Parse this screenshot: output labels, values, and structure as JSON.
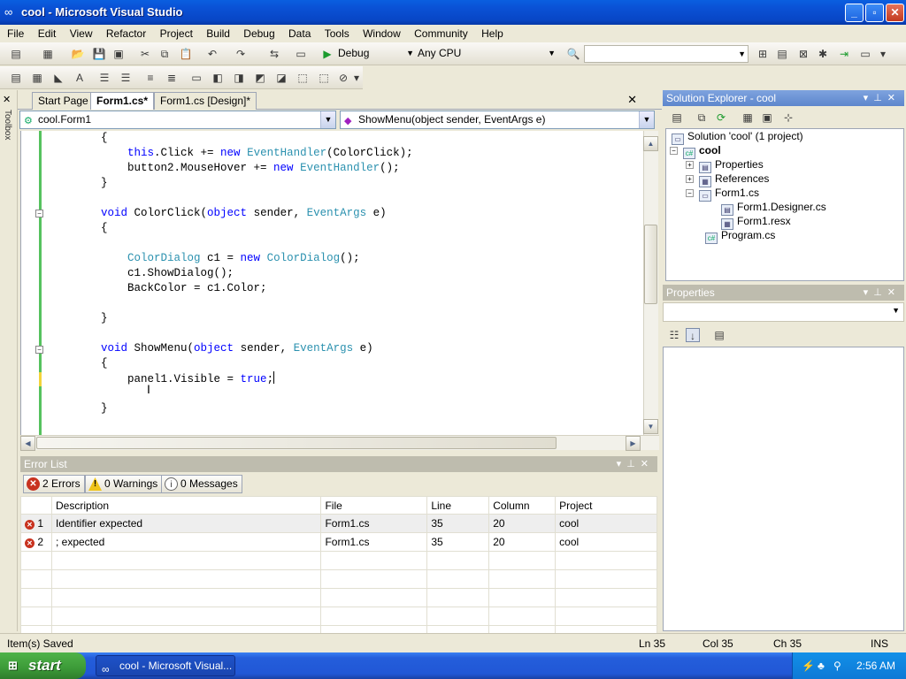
{
  "window": {
    "title": "cool - Microsoft Visual Studio",
    "minimize": "_",
    "maximize": "▫",
    "close": "✕"
  },
  "menu": [
    "File",
    "Edit",
    "View",
    "Refactor",
    "Project",
    "Build",
    "Debug",
    "Data",
    "Tools",
    "Window",
    "Community",
    "Help"
  ],
  "toolbar": {
    "config": "Debug",
    "platform": "Any CPU",
    "find": ""
  },
  "toolbox_label": "Toolbox",
  "tabs": [
    {
      "label": "Start Page"
    },
    {
      "label": "Form1.cs*"
    },
    {
      "label": "Form1.cs [Design]*"
    }
  ],
  "navbar": {
    "class_combo": "cool.Form1",
    "member_combo": "ShowMenu(object sender, EventArgs e)"
  },
  "code": [
    [
      [
        "",
        "        {"
      ]
    ],
    [
      [
        "",
        "            "
      ],
      [
        "kw",
        "this"
      ],
      [
        "",
        ".Click += "
      ],
      [
        "kw",
        "new"
      ],
      [
        "",
        ""
      ],
      [
        "ty",
        " EventHandler"
      ],
      [
        "",
        "(ColorClick);"
      ]
    ],
    [
      [
        "",
        "            button2.MouseHover += "
      ],
      [
        "kw",
        "new"
      ],
      [
        "ty",
        " EventHandler"
      ],
      [
        "",
        "();"
      ]
    ],
    [
      [
        "",
        "        }"
      ]
    ],
    [
      [
        "",
        ""
      ]
    ],
    [
      [
        "",
        "        "
      ],
      [
        "kw",
        "void"
      ],
      [
        "",
        " ColorClick("
      ],
      [
        "kw",
        "object"
      ],
      [
        "",
        " sender, "
      ],
      [
        "ty",
        "EventArgs"
      ],
      [
        "",
        " e)"
      ]
    ],
    [
      [
        "",
        "        {"
      ]
    ],
    [
      [
        "",
        ""
      ]
    ],
    [
      [
        "",
        "            "
      ],
      [
        "ty",
        "ColorDialog"
      ],
      [
        "",
        " c1 = "
      ],
      [
        "kw",
        "new"
      ],
      [
        "ty",
        " ColorDialog"
      ],
      [
        "",
        "();"
      ]
    ],
    [
      [
        "",
        "            c1.ShowDialog();"
      ]
    ],
    [
      [
        "",
        "            BackColor = c1.Color;"
      ]
    ],
    [
      [
        "",
        ""
      ]
    ],
    [
      [
        "",
        "        }"
      ]
    ],
    [
      [
        "",
        ""
      ]
    ],
    [
      [
        "",
        "        "
      ],
      [
        "kw",
        "void"
      ],
      [
        "",
        " ShowMenu("
      ],
      [
        "kw",
        "object"
      ],
      [
        "",
        " sender, "
      ],
      [
        "ty",
        "EventArgs"
      ],
      [
        "",
        " e)"
      ]
    ],
    [
      [
        "",
        "        {"
      ]
    ],
    [
      [
        "",
        "            panel1.Visible = "
      ],
      [
        "kw",
        "true"
      ],
      [
        "",
        ";"
      ]
    ],
    [
      [
        "",
        ""
      ]
    ],
    [
      [
        "",
        "        }"
      ]
    ]
  ],
  "solution_explorer": {
    "title": "Solution Explorer - cool",
    "items": [
      {
        "label": "Solution 'cool' (1 project)"
      },
      {
        "label": "cool"
      },
      {
        "label": "Properties"
      },
      {
        "label": "References"
      },
      {
        "label": "Form1.cs"
      },
      {
        "label": "Form1.Designer.cs"
      },
      {
        "label": "Form1.resx"
      },
      {
        "label": "Program.cs"
      }
    ]
  },
  "properties": {
    "title": "Properties"
  },
  "error_list": {
    "title": "Error List",
    "errors_btn": "2 Errors",
    "warnings_btn": "0 Warnings",
    "messages_btn": "0 Messages",
    "columns": [
      "",
      "Description",
      "File",
      "Line",
      "Column",
      "Project"
    ],
    "rows": [
      {
        "num": "1",
        "description": "Identifier expected",
        "file": "Form1.cs",
        "line": "35",
        "column": "20",
        "project": "cool"
      },
      {
        "num": "2",
        "description": "; expected",
        "file": "Form1.cs",
        "line": "35",
        "column": "20",
        "project": "cool"
      }
    ]
  },
  "status": {
    "message": "Item(s) Saved",
    "ln": "Ln 35",
    "col": "Col 35",
    "ch": "Ch 35",
    "mode": "INS"
  },
  "taskbar": {
    "start": "start",
    "item": "cool - Microsoft Visual...",
    "clock": "2:56 AM"
  },
  "colors": {
    "keyword": "#0000ff",
    "type": "#2b91af",
    "titlebar": "#0a52d6"
  }
}
